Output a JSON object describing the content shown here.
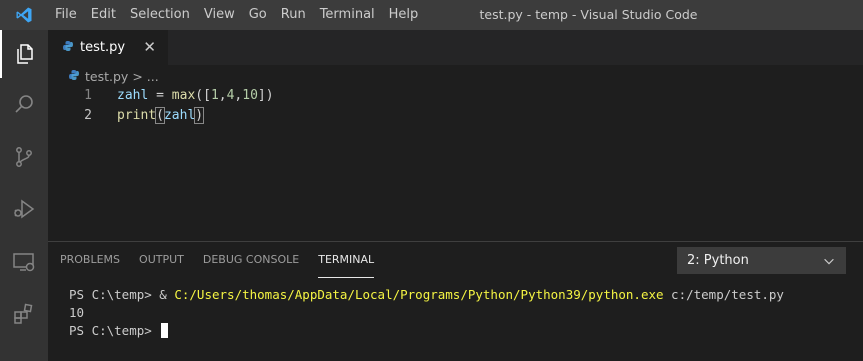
{
  "window": {
    "title": "test.py - temp - Visual Studio Code"
  },
  "menu": [
    "File",
    "Edit",
    "Selection",
    "View",
    "Go",
    "Run",
    "Terminal",
    "Help"
  ],
  "activity_bar": {
    "items": [
      "explorer-icon",
      "search-icon",
      "source-control-icon",
      "run-debug-icon",
      "remote-explorer-icon",
      "extensions-icon"
    ]
  },
  "editor": {
    "tab": {
      "label": "test.py",
      "close": "✕"
    },
    "breadcrumb": {
      "file": "test.py",
      "separator": ">",
      "rest": "..."
    },
    "lines": [
      {
        "number": "1",
        "tokens": [
          {
            "t": "zahl",
            "c": "var"
          },
          {
            "t": " = ",
            "c": "op"
          },
          {
            "t": "max",
            "c": "fn"
          },
          {
            "t": "([",
            "c": "pn"
          },
          {
            "t": "1",
            "c": "num"
          },
          {
            "t": ",",
            "c": "pn"
          },
          {
            "t": "4",
            "c": "num"
          },
          {
            "t": ",",
            "c": "pn"
          },
          {
            "t": "10",
            "c": "num"
          },
          {
            "t": "])",
            "c": "pn"
          }
        ]
      },
      {
        "number": "2",
        "tokens": [
          {
            "t": "print",
            "c": "fn"
          },
          {
            "t": "(",
            "c": "pn",
            "hl": true
          },
          {
            "t": "zahl",
            "c": "var"
          },
          {
            "t": ")",
            "c": "pn",
            "hl": true
          }
        ]
      }
    ]
  },
  "panel": {
    "tabs": [
      "PROBLEMS",
      "OUTPUT",
      "DEBUG CONSOLE",
      "TERMINAL"
    ],
    "active_tab": "TERMINAL",
    "terminal_select": "2: Python",
    "terminal": {
      "line1_prompt": "PS C:\\temp> & ",
      "line1_path": "C:/Users/thomas/AppData/Local/Programs/Python/Python39/python.exe",
      "line1_arg": " c:/temp/test.py",
      "output": "10",
      "prompt": "PS C:\\temp> "
    }
  },
  "colors": {
    "accent": "#007acc",
    "titlebar": "#3c3c3c",
    "activitybar": "#333333",
    "editor_bg": "#1e1e1e",
    "terminal_path": "#f5f543"
  }
}
